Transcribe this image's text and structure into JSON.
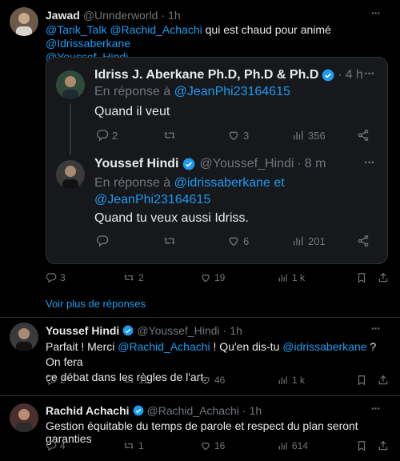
{
  "tweets": [
    {
      "name": "Jawad",
      "handle": "@Unnderworld",
      "dot": "·",
      "time": "1h",
      "text_mentions_1": "@Tarik_Talk @Rachid_Achachi",
      "text_plain": " qui est chaud pour animé ",
      "text_mentions_2": "@Idrissaberkane",
      "text_mentions_3": "@Youssef_Hindi",
      "replies": "3",
      "retweets": "2",
      "likes": "19",
      "views": "1 k"
    },
    {
      "name": "Youssef Hindi",
      "handle": "@Youssef_Hindi",
      "dot": "·",
      "time": "1h",
      "text_1": "Parfait ! Merci ",
      "mention_1": "@Rachid_Achachi",
      "text_2": " ! Qu'en dis-tu ",
      "mention_2": "@idrissaberkane",
      "text_3": " ? On fera",
      "text_4": "ce débat dans les règles de l'art.",
      "replies": "2",
      "retweets": "11",
      "likes": "46",
      "views": "1 k"
    },
    {
      "name": "Rachid Achachi",
      "handle": "@Rachid_Achachi",
      "dot": "·",
      "time": "1h",
      "text": "Gestion équitable du temps de parole et respect du plan seront garanties",
      "replies": "4",
      "retweets": "1",
      "likes": "16",
      "views": "614"
    }
  ],
  "quote": {
    "first": {
      "name": "Idriss J. Aberkane Ph.D, Ph.D & Ph.D",
      "dot": "·",
      "time": "4 h",
      "reply_prefix": "En réponse à ",
      "reply_to": "@JeanPhi23164615",
      "text": "Quand il veut",
      "replies": "2",
      "retweets": "",
      "likes": "3",
      "views": "356"
    },
    "second": {
      "name": "Youssef Hindi",
      "handle": "@Youssef_Hindi",
      "dot": "·",
      "time": "8 m",
      "reply_prefix": "En réponse à ",
      "reply_to_1": "@idrissaberkane",
      "reply_and": " et",
      "reply_to_2": "@JeanPhi23164615",
      "text": "Quand tu veux aussi Idriss.",
      "likes": "6",
      "views": "201"
    }
  },
  "show_more": "Voir plus de réponses",
  "colors": {
    "accent": "#1d9bf0",
    "muted": "#71767b",
    "text": "#e7e9ea",
    "background": "#000000"
  }
}
